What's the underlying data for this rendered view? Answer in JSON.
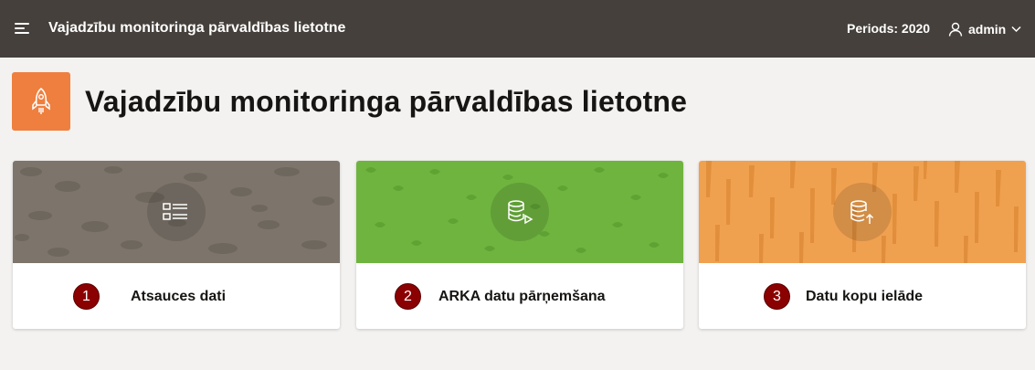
{
  "header": {
    "menu_icon": "hamburger-menu-icon",
    "app_name": "Vajadzību monitoringa pārvaldības lietotne",
    "period": "Periods: 2020",
    "user": {
      "icon": "user-icon",
      "name": "admin",
      "chevron": "chevron-down-icon"
    }
  },
  "hero": {
    "icon": "rocket-icon",
    "icon_bg": "#ef7f3e",
    "title": "Vajadzību monitoringa pārvaldības lietotne"
  },
  "cards": [
    {
      "number": "1",
      "title": "Atsauces dati",
      "icon": "list-icon",
      "banner_color": "#7d756b"
    },
    {
      "number": "2",
      "title": "ARKA datu pārņemšana",
      "icon": "database-play-icon",
      "banner_color": "#6fb43f"
    },
    {
      "number": "3",
      "title": "Datu kopu ielāde",
      "icon": "database-upload-icon",
      "banner_color": "#f0a150"
    }
  ],
  "colors": {
    "topbar": "#45403b",
    "badge": "#8b0000",
    "page_bg": "#f3f2f1"
  }
}
